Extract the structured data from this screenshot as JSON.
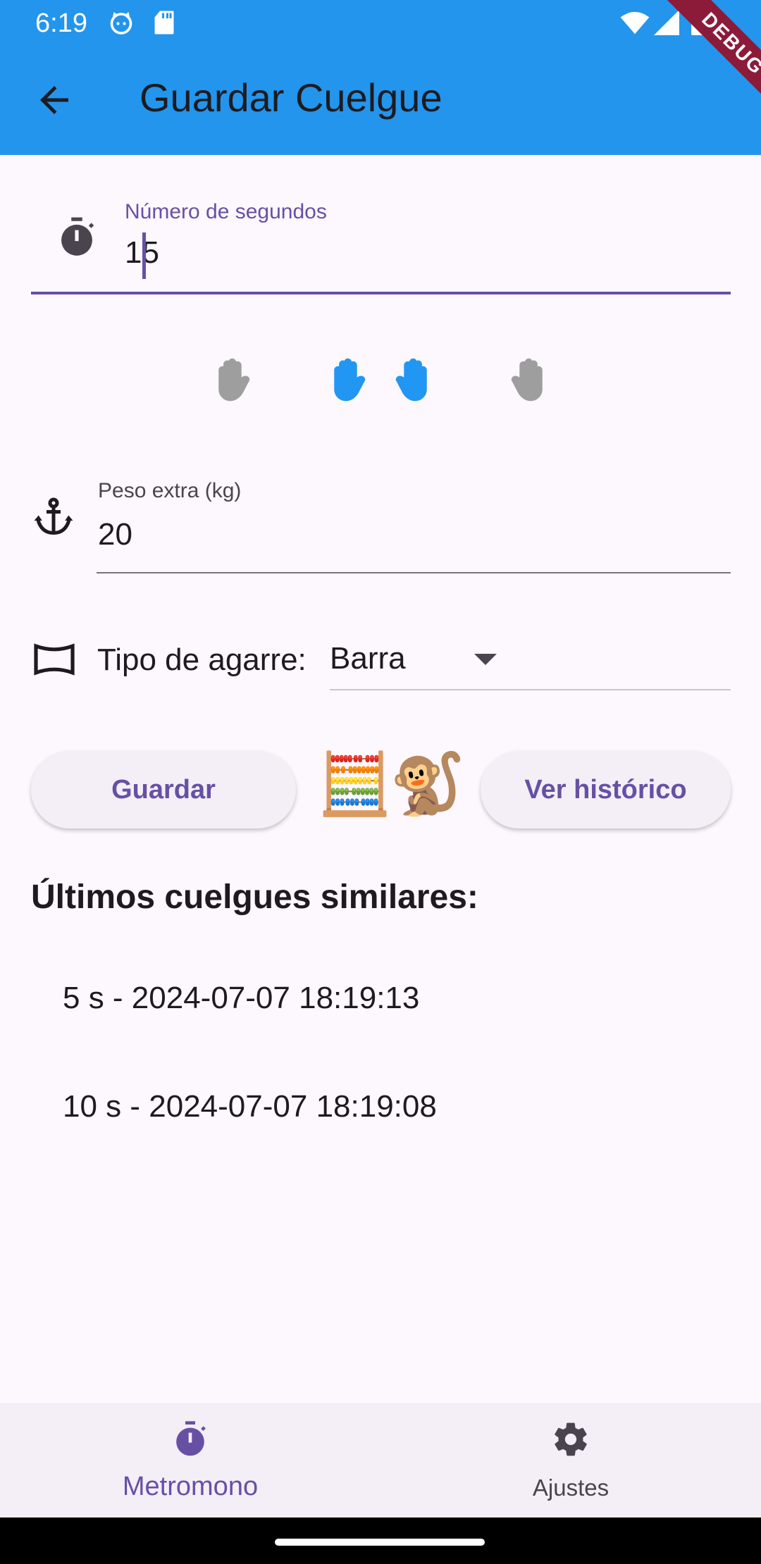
{
  "status_bar": {
    "time": "6:19",
    "icons": [
      "cat-notification-icon",
      "sd-card-icon",
      "wifi-icon",
      "signal-icon",
      "battery-icon"
    ]
  },
  "app_bar": {
    "title": "Guardar Cuelgue",
    "background_color": "#2395ec",
    "debug_banner": "DEBUG"
  },
  "seconds_field": {
    "label": "Número de segundos",
    "value": "15",
    "icon": "timer-icon",
    "focus_color": "#6750a4"
  },
  "hands": {
    "items": [
      {
        "name": "left-hand-icon",
        "selected": false
      },
      {
        "name": "both-hands-icon",
        "selected": true
      },
      {
        "name": "right-hand-icon",
        "selected": false
      }
    ],
    "selected_color": "#2196f3",
    "unselected_color": "#9e9e9e"
  },
  "weight_field": {
    "label": "Peso extra (kg)",
    "value": "20",
    "icon": "anchor-icon"
  },
  "grip": {
    "label": "Tipo de agarre:",
    "value": "Barra",
    "icon": "crop-landscape-icon"
  },
  "actions": {
    "save_label": "Guardar",
    "history_label": "Ver histórico",
    "emojis": [
      "🧮",
      "🐒"
    ]
  },
  "recent": {
    "title": "Últimos cuelgues similares:",
    "items": [
      "5 s - 2024-07-07 18:19:13",
      "10 s - 2024-07-07 18:19:08"
    ]
  },
  "bottom_nav": {
    "items": [
      {
        "label": "Metromono",
        "icon": "timer-icon",
        "active": true
      },
      {
        "label": "Ajustes",
        "icon": "settings-icon",
        "active": false
      }
    ],
    "active_color": "#6750a4",
    "inactive_color": "#49454f"
  }
}
